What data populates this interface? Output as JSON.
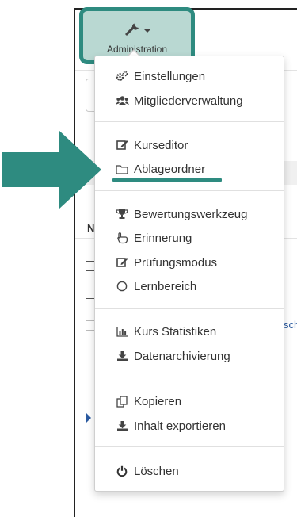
{
  "admin_button": {
    "label": "Administration",
    "icon": "wrench-icon"
  },
  "background_page": {
    "fragment_n": "N",
    "fragment_sch": "sch"
  },
  "menu": {
    "items": [
      {
        "label": "Einstellungen",
        "icon": "cogs-icon"
      },
      {
        "label": "Mitgliederverwaltung",
        "icon": "users-icon"
      },
      {
        "label": "Kurseditor",
        "icon": "edit-icon"
      },
      {
        "label": "Ablageordner",
        "icon": "folder-icon"
      },
      {
        "label": "Bewertungswerkzeug",
        "icon": "trophy-icon"
      },
      {
        "label": "Erinnerung",
        "icon": "hand-pointer-icon"
      },
      {
        "label": "Prüfungsmodus",
        "icon": "edit-icon"
      },
      {
        "label": "Lernbereich",
        "icon": "circle-icon"
      },
      {
        "label": "Kurs Statistiken",
        "icon": "bar-chart-icon"
      },
      {
        "label": "Datenarchivierung",
        "icon": "download-icon"
      },
      {
        "label": "Kopieren",
        "icon": "copy-icon"
      },
      {
        "label": "Inhalt exportieren",
        "icon": "download-icon"
      },
      {
        "label": "Löschen",
        "icon": "power-icon"
      }
    ]
  },
  "colors": {
    "annotation_teal": "#2e8b80",
    "button_fill": "#b9d8d2"
  }
}
